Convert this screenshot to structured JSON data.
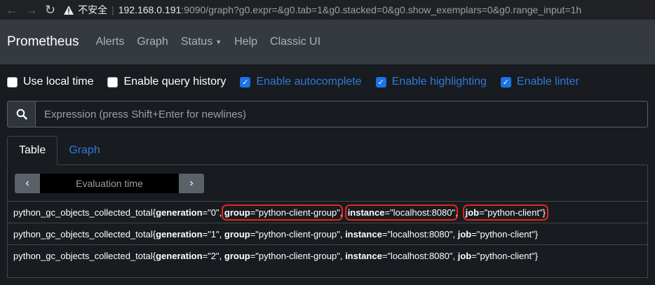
{
  "browser": {
    "back_icon": "arrow-left-icon",
    "forward_icon": "arrow-right-icon",
    "reload_icon": "reload-icon",
    "security_label": "不安全",
    "url_host": "192.168.0.191",
    "url_rest": ":9090/graph?g0.expr=&g0.tab=1&g0.stacked=0&g0.show_exemplars=0&g0.range_input=1h"
  },
  "navbar": {
    "brand": "Prometheus",
    "links": [
      "Alerts",
      "Graph",
      "Status",
      "Help",
      "Classic UI"
    ]
  },
  "options": [
    {
      "label": "Use local time",
      "checked": false
    },
    {
      "label": "Enable query history",
      "checked": false
    },
    {
      "label": "Enable autocomplete",
      "checked": true
    },
    {
      "label": "Enable highlighting",
      "checked": true
    },
    {
      "label": "Enable linter",
      "checked": true
    }
  ],
  "expression": {
    "placeholder": "Expression (press Shift+Enter for newlines)",
    "value": "",
    "button_icon": "search-icon"
  },
  "panel": {
    "tabs": [
      "Table",
      "Graph"
    ],
    "active_tab": "Table",
    "evaluation": {
      "prev_icon": "chevron-left-icon",
      "next_icon": "chevron-right-icon",
      "placeholder": "Evaluation time"
    },
    "results": [
      {
        "metric": "python_gc_objects_collected_total",
        "generation": "0",
        "group": "python-client-group",
        "instance": "localhost:8080",
        "job": "python-client"
      },
      {
        "metric": "python_gc_objects_collected_total",
        "generation": "1",
        "group": "python-client-group",
        "instance": "localhost:8080",
        "job": "python-client"
      },
      {
        "metric": "python_gc_objects_collected_total",
        "generation": "2",
        "group": "python-client-group",
        "instance": "localhost:8080",
        "job": "python-client"
      }
    ]
  },
  "colors": {
    "highlight_box": "#e1261c",
    "link_blue": "#2f7ad9",
    "navbar_bg": "#343a40",
    "page_bg": "#181b1f"
  }
}
